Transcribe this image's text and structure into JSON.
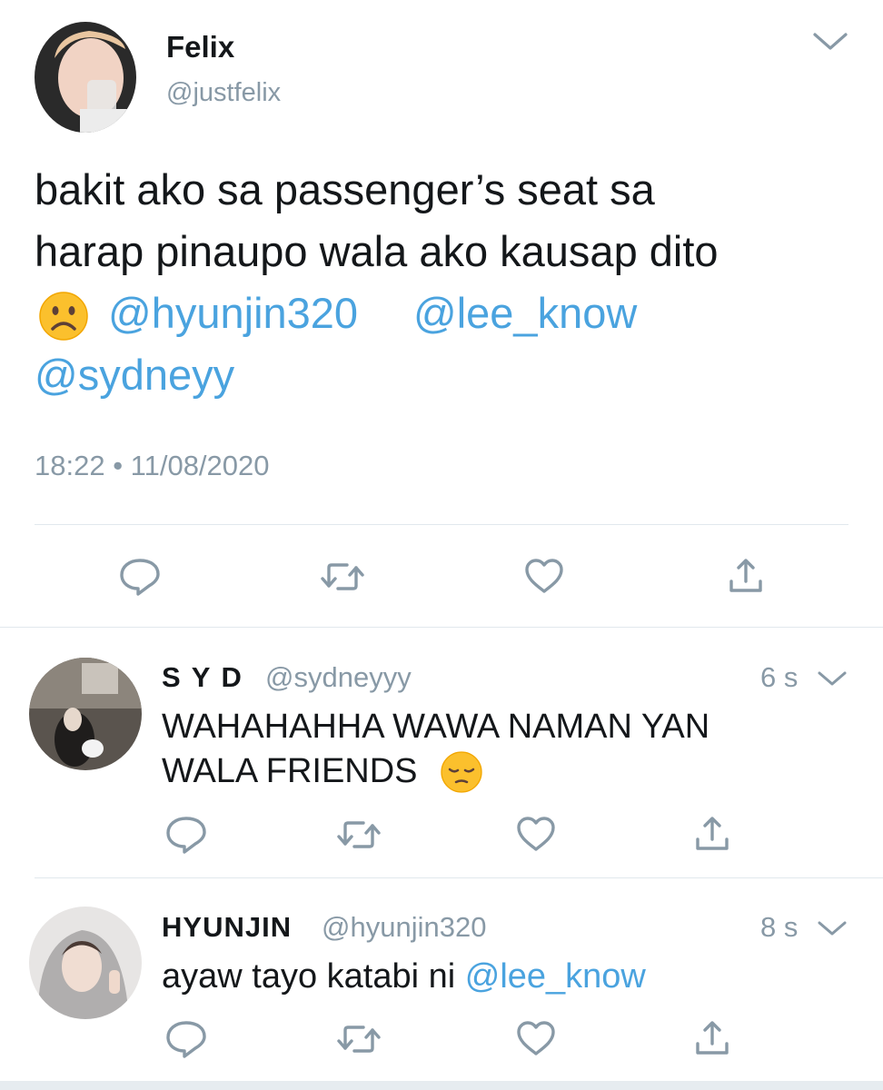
{
  "main_tweet": {
    "display_name": "Felix",
    "handle": "@justfelix",
    "text_line1": "bakit ako sa passenger’s seat sa",
    "text_line2": "harap pinaupo wala ako kausap dito",
    "mentions": [
      "@hyunjin320",
      "@lee_know",
      "@sydneyy"
    ],
    "timestamp": "18:22 • 11/08/2020"
  },
  "replies": [
    {
      "display_name": "S Y D",
      "handle": "@sydneyyy",
      "time": "6 s",
      "text_line1": "WAHAHAHHA WAWA NAMAN YAN",
      "text_line2": "WALA FRIENDS"
    },
    {
      "display_name": "HYUNJIN",
      "handle": "@hyunjin320",
      "time": "8 s",
      "text": "ayaw tayo katabi ni ",
      "mention": "@lee_know"
    }
  ],
  "colors": {
    "mention": "#4aa3df",
    "muted": "#8899a6",
    "divider": "#e1e8ed"
  },
  "icons": [
    "chevron-down-icon",
    "reply-icon",
    "retweet-icon",
    "like-icon",
    "share-icon",
    "frowning-face-emoji",
    "pensive-face-emoji"
  ]
}
